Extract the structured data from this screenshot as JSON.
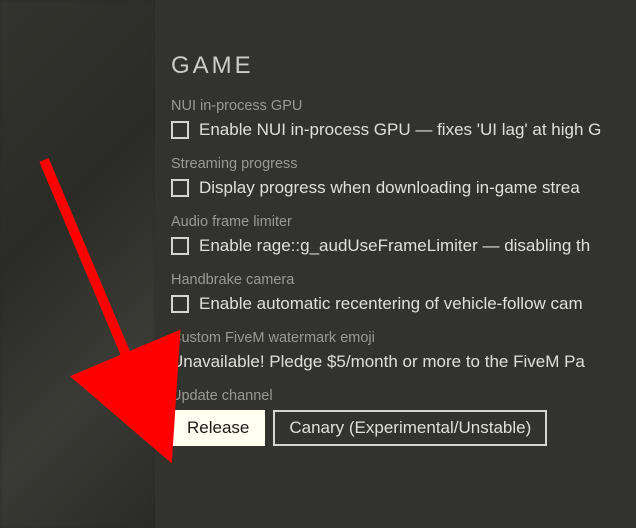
{
  "section": {
    "title": "GAME"
  },
  "settings": {
    "nui_gpu": {
      "label": "NUI in-process GPU",
      "checkbox_text": "Enable NUI in-process GPU — fixes 'UI lag' at high G"
    },
    "streaming": {
      "label": "Streaming progress",
      "checkbox_text": "Display progress when downloading in-game strea"
    },
    "audio_limiter": {
      "label": "Audio frame limiter",
      "checkbox_text": "Enable rage::g_audUseFrameLimiter — disabling th"
    },
    "handbrake": {
      "label": "Handbrake camera",
      "checkbox_text": "Enable automatic recentering of vehicle-follow cam"
    },
    "watermark": {
      "label": "Custom FiveM watermark emoji",
      "text": "Unavailable! Pledge $5/month or more to the FiveM Pa"
    },
    "update_channel": {
      "label": "Update channel",
      "options": {
        "release": "Release",
        "canary": "Canary (Experimental/Unstable)"
      }
    }
  }
}
